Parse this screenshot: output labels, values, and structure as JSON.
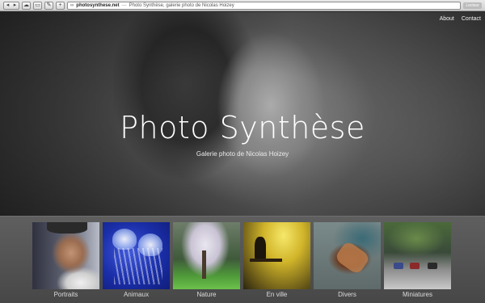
{
  "browser": {
    "back_label": "◂",
    "forward_label": "▸",
    "url_domain": "photosynthese.net",
    "url_separator": "—",
    "page_title": "Photo Synthèse, galerie photo de Nicolas Hoizey",
    "reader_label": "Lecteur"
  },
  "nav": {
    "about": "About",
    "contact": "Contact"
  },
  "hero": {
    "title": "Photo Synthèse",
    "subtitle": "Galerie photo de Nicolas Hoizey"
  },
  "gallery": {
    "items": [
      {
        "label": "Portraits"
      },
      {
        "label": "Animaux"
      },
      {
        "label": "Nature"
      },
      {
        "label": "En ville"
      },
      {
        "label": "Divers"
      },
      {
        "label": "Miniatures"
      }
    ]
  }
}
